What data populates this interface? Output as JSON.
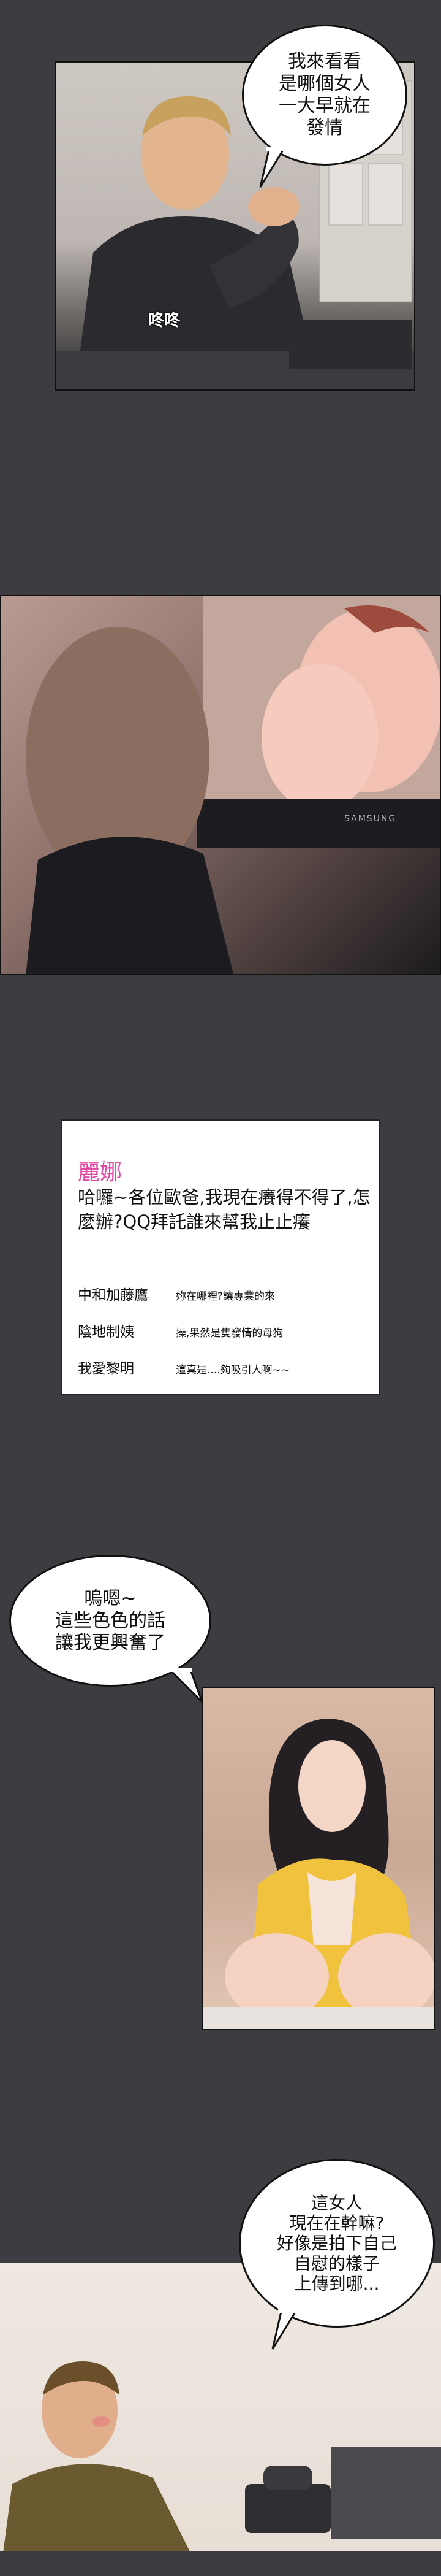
{
  "panel1": {
    "bubble_text": "我來看看\n是哪個女人\n一大早就在\n發情",
    "sfx": "咚咚"
  },
  "panel2": {
    "monitor_brand": "SAMSUNG"
  },
  "chat": {
    "poster_name": "麗娜",
    "post_text": "哈囉~各位歐爸,我現在癢得不得了,怎麼辦?QQ拜託誰來幫我止止癢",
    "comments": [
      {
        "user": "中和加藤鷹",
        "text": "妳在哪裡?讓專業的來"
      },
      {
        "user": "陰地制姨",
        "text": "操,果然是隻發情的母狗"
      },
      {
        "user": "我愛黎明",
        "text": "這真是....夠吸引人啊~~"
      }
    ]
  },
  "panel4": {
    "bubble_text": "嗚嗯~\n這些色色的話\n讓我更興奮了"
  },
  "panel5": {
    "bubble_text": "這女人\n現在在幹嘛?\n好像是拍下自己\n自慰的樣子\n上傳到哪..."
  },
  "colors": {
    "gutter": "#3d3c41",
    "poster_name": "#e24aa5",
    "bubble_border": "#111111"
  }
}
